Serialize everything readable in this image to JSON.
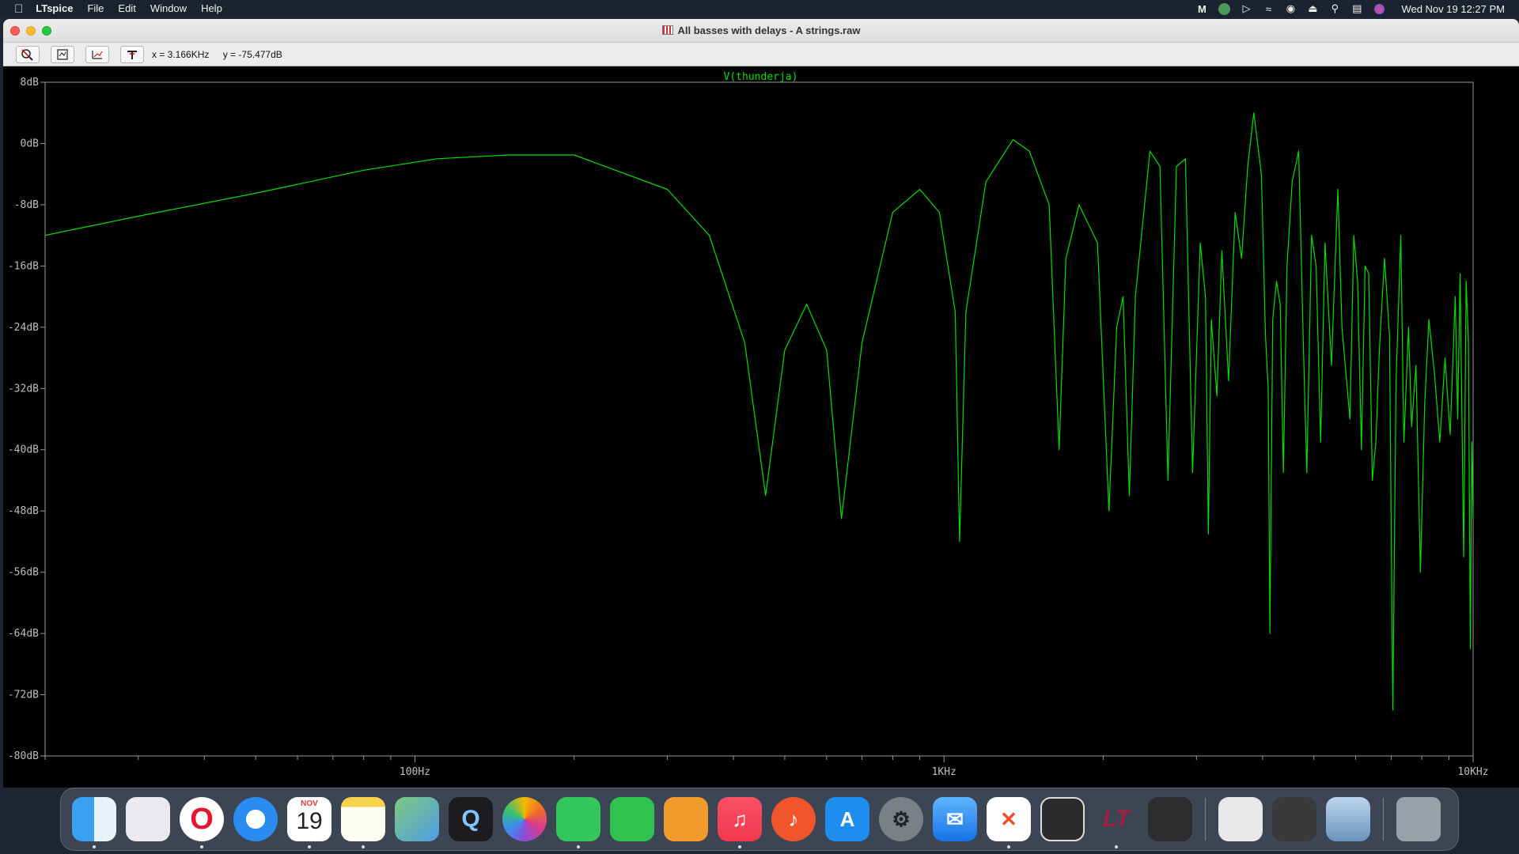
{
  "menubar": {
    "app_name": "LTspice",
    "menus": [
      "File",
      "Edit",
      "Window",
      "Help"
    ],
    "status_icons": [
      "mimestream-icon",
      "grammarly-icon",
      "play-icon",
      "wifi-icon",
      "user-icon",
      "eject-icon",
      "search-icon",
      "control-center-icon",
      "siri-icon"
    ],
    "clock": "Wed Nov 19  12:27 PM"
  },
  "window": {
    "title": "All basses with delays - A strings.raw"
  },
  "toolbar": {
    "buttons": [
      "zoom-cancel-icon",
      "zoom-fit-icon",
      "zoom-back-icon",
      "probe-icon"
    ],
    "readout_x": "x = 3.166KHz",
    "readout_y": "y = -75.477dB"
  },
  "chart_data": {
    "type": "line",
    "title": "V(thunderja)",
    "xscale": "log",
    "xlim_hz": [
      20,
      10000
    ],
    "ylim_db": [
      -80,
      8
    ],
    "y_ticks": [
      "8dB",
      "0dB",
      "-8dB",
      "-16dB",
      "-24dB",
      "-32dB",
      "-40dB",
      "-48dB",
      "-56dB",
      "-64dB",
      "-72dB",
      "-80dB"
    ],
    "x_ticks": [
      "100Hz",
      "1KHz",
      "10KHz"
    ],
    "color": "#00e000",
    "series": [
      {
        "points": [
          [
            20,
            -12
          ],
          [
            30,
            -9.5
          ],
          [
            50,
            -6.5
          ],
          [
            80,
            -3.5
          ],
          [
            110,
            -2
          ],
          [
            150,
            -1.5
          ],
          [
            200,
            -1.5
          ],
          [
            300,
            -6
          ],
          [
            360,
            -12
          ],
          [
            420,
            -26
          ],
          [
            460,
            -46
          ],
          [
            500,
            -27
          ],
          [
            550,
            -21
          ],
          [
            600,
            -27
          ],
          [
            640,
            -49
          ],
          [
            700,
            -26
          ],
          [
            800,
            -9
          ],
          [
            900,
            -6
          ],
          [
            980,
            -9
          ],
          [
            1050,
            -22
          ],
          [
            1070,
            -52
          ],
          [
            1100,
            -22
          ],
          [
            1200,
            -5
          ],
          [
            1350,
            0.5
          ],
          [
            1450,
            -1
          ],
          [
            1580,
            -8
          ],
          [
            1650,
            -40
          ],
          [
            1700,
            -15
          ],
          [
            1800,
            -8
          ],
          [
            1950,
            -13
          ],
          [
            2050,
            -48
          ],
          [
            2120,
            -24
          ],
          [
            2180,
            -20
          ],
          [
            2240,
            -46
          ],
          [
            2300,
            -20
          ],
          [
            2450,
            -1
          ],
          [
            2560,
            -3
          ],
          [
            2650,
            -44
          ],
          [
            2750,
            -3
          ],
          [
            2860,
            -2
          ],
          [
            2950,
            -43
          ],
          [
            3050,
            -13
          ],
          [
            3120,
            -20
          ],
          [
            3160,
            -51
          ],
          [
            3200,
            -23
          ],
          [
            3280,
            -33
          ],
          [
            3350,
            -14
          ],
          [
            3450,
            -31
          ],
          [
            3550,
            -9
          ],
          [
            3650,
            -15
          ],
          [
            3750,
            -3
          ],
          [
            3850,
            4
          ],
          [
            3980,
            -4
          ],
          [
            4050,
            -25
          ],
          [
            4100,
            -32
          ],
          [
            4130,
            -64
          ],
          [
            4180,
            -23
          ],
          [
            4250,
            -18
          ],
          [
            4320,
            -21
          ],
          [
            4380,
            -43
          ],
          [
            4450,
            -16
          ],
          [
            4550,
            -5
          ],
          [
            4680,
            -1
          ],
          [
            4780,
            -27
          ],
          [
            4850,
            -43
          ],
          [
            4950,
            -12
          ],
          [
            5050,
            -16
          ],
          [
            5150,
            -39
          ],
          [
            5250,
            -13
          ],
          [
            5400,
            -29
          ],
          [
            5550,
            -6
          ],
          [
            5650,
            -24
          ],
          [
            5850,
            -36
          ],
          [
            5950,
            -12
          ],
          [
            6050,
            -18
          ],
          [
            6150,
            -40
          ],
          [
            6250,
            -16
          ],
          [
            6350,
            -17
          ],
          [
            6450,
            -44
          ],
          [
            6550,
            -39
          ],
          [
            6650,
            -27
          ],
          [
            6800,
            -15
          ],
          [
            6950,
            -25
          ],
          [
            7050,
            -74
          ],
          [
            7150,
            -31
          ],
          [
            7300,
            -12
          ],
          [
            7400,
            -39
          ],
          [
            7550,
            -24
          ],
          [
            7650,
            -37
          ],
          [
            7800,
            -29
          ],
          [
            7950,
            -56
          ],
          [
            8100,
            -34
          ],
          [
            8250,
            -23
          ],
          [
            8450,
            -30
          ],
          [
            8650,
            -39
          ],
          [
            8850,
            -28
          ],
          [
            9050,
            -38
          ],
          [
            9250,
            -20
          ],
          [
            9350,
            -36
          ],
          [
            9450,
            -17
          ],
          [
            9600,
            -54
          ],
          [
            9700,
            -18
          ],
          [
            9800,
            -26
          ],
          [
            9880,
            -66
          ],
          [
            9940,
            -39
          ],
          [
            10000,
            -49
          ]
        ]
      }
    ]
  },
  "dock": {
    "apps": [
      {
        "name": "finder-icon",
        "label": ""
      },
      {
        "name": "launchpad-icon",
        "label": ""
      },
      {
        "name": "opera-icon",
        "label": "O"
      },
      {
        "name": "safari-icon",
        "label": ""
      },
      {
        "name": "calendar-icon",
        "month": "NOV",
        "day": "19"
      },
      {
        "name": "notes-icon",
        "label": ""
      },
      {
        "name": "maps-icon",
        "label": ""
      },
      {
        "name": "quicktime-icon",
        "label": "Q"
      },
      {
        "name": "photos-icon",
        "label": ""
      },
      {
        "name": "messages-icon",
        "label": ""
      },
      {
        "name": "facetime-icon",
        "label": ""
      },
      {
        "name": "pages-icon",
        "label": ""
      },
      {
        "name": "music-icon",
        "label": "♫"
      },
      {
        "name": "capo-icon",
        "label": "♪"
      },
      {
        "name": "app-store-icon",
        "label": "A"
      },
      {
        "name": "system-settings-icon",
        "label": "⚙"
      },
      {
        "name": "mail-icon",
        "label": "✉"
      },
      {
        "name": "spark-icon",
        "label": "✕"
      },
      {
        "name": "screenshot-icon",
        "label": ""
      },
      {
        "name": "ltspice-icon",
        "label": "LT"
      },
      {
        "name": "calculator-icon",
        "label": ""
      },
      {
        "name": "chip-utility-icon",
        "label": ""
      },
      {
        "name": "image-capture-icon",
        "label": ""
      },
      {
        "name": "preview-icon",
        "label": ""
      },
      {
        "name": "trash-icon",
        "label": ""
      }
    ]
  }
}
